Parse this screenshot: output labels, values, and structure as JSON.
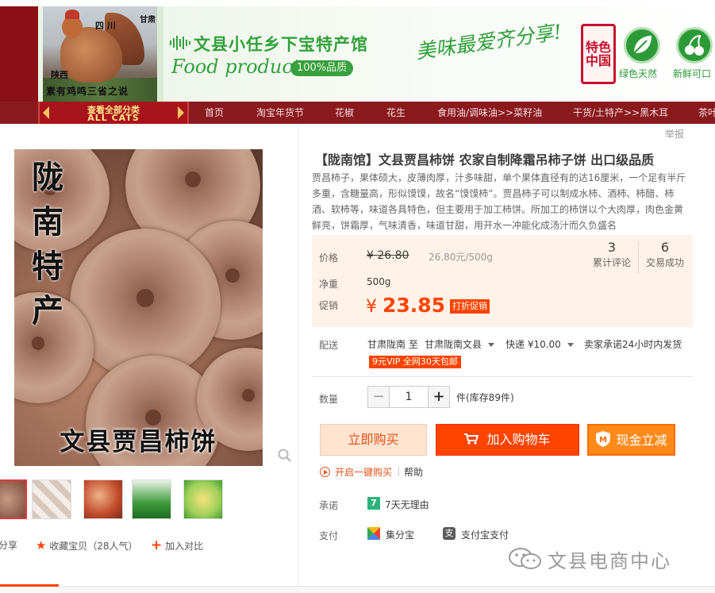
{
  "banner": {
    "photo_text_1": "四 川",
    "photo_text_2": "甘肃",
    "photo_text_3": "陕西",
    "photo_text_4": "素有鸡鸣三省之说",
    "title": "文县小任乡下宝特产馆",
    "subtitle": "Food products",
    "badge": "100%品质",
    "slogan": "美味最爱齐分享!",
    "seal": [
      "特色",
      "中国"
    ],
    "icon1_label": "绿色天然",
    "icon2_label": "新鲜可口"
  },
  "nav": {
    "allcats_cn": "查看全部分类",
    "allcats_en": "ALL CATS",
    "items": [
      "首页",
      "淘宝年货节",
      "花椒",
      "花生",
      "食用油/调味油>>菜籽油",
      "干货/土特产>>黑木耳",
      "茶叶"
    ]
  },
  "gallery": {
    "image_vertical_text": [
      "陇",
      "南",
      "特",
      "产"
    ],
    "image_bottom_text": "文县贾昌柿饼",
    "actions": {
      "share": "分享",
      "favorite": "收藏宝贝（28人气）",
      "compare": "加入对比"
    }
  },
  "product": {
    "report": "举报",
    "title": "【陇南馆】文县贾昌柿饼 农家自制降霜吊柿子饼 出口级品质",
    "description": "贾昌柿子，果体硕大，皮薄肉厚，汁多味甜，单个果体直径有的达16厘米，一个足有半斤多重，含糖量高，形似馍馍，故名“馍馍柿”。贾昌柿子可以制成水柿、酒柿、柿醋、柿酒、软柿等，味道各具特色，但主要用于加工柿饼。所加工的柿饼以个大肉厚，肉色金黄鲜亮，饼霜厚，气味清香，味道甘甜，用开水一冲能化成汤汁而久负盛名",
    "price_label": "价格",
    "price_currency": "¥",
    "price_original": "26.80",
    "price_per_unit": "26.80元/500g",
    "weight_label": "净重",
    "weight": "500g",
    "promo_label": "促销",
    "promo_price": "23.85",
    "promo_tag": "打折促销",
    "reviews_count": "3",
    "reviews_label": "累计评论",
    "deals_count": "6",
    "deals_label": "交易成功",
    "shipping_label": "配送",
    "ship_from": "甘肃陇南 至",
    "ship_to": "甘肃陇南文县",
    "ship_method": "快递 ¥10.00",
    "ship_promise": "卖家承诺24小时内发货",
    "vip_tag": "9元VIP 全网30天包邮",
    "qty_label": "数量",
    "qty_value": "1",
    "qty_minus": "−",
    "qty_plus": "+",
    "stock": "件(库存89件)",
    "buy_now": "立即购买",
    "add_to_cart": "加入购物车",
    "cash_off": "现金立减",
    "one_click": "开启一键购买",
    "help": "帮助",
    "promise_label": "承诺",
    "promise_icon": "7",
    "promise_text": "7天无理由",
    "pay_label": "支付",
    "pay_jfb": "集分宝",
    "pay_alipay": "支付宝支付",
    "alipay_icon": "支"
  },
  "watermark": "文县电商中心",
  "colors": {
    "accent": "#ff4400",
    "brand_green": "#33a13d",
    "nav_red": "#8a1a1e"
  }
}
